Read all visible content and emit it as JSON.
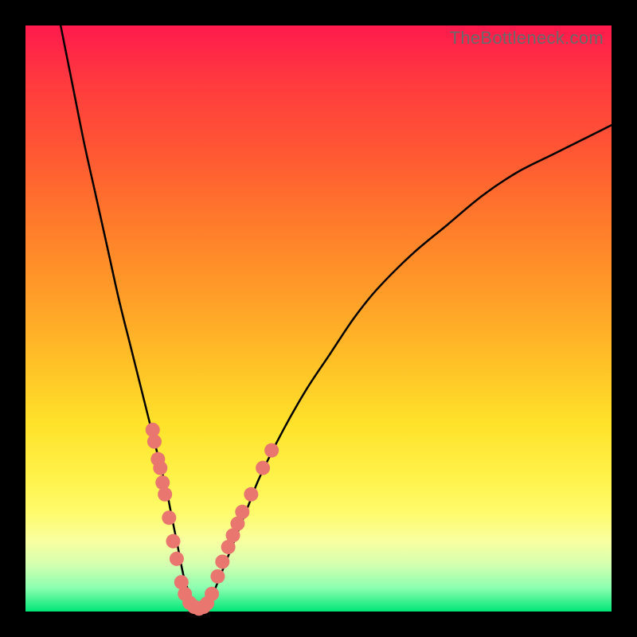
{
  "watermark": "TheBottleneck.com",
  "colors": {
    "curve_stroke": "#000000",
    "dot_fill": "#e9776f",
    "dot_stroke": "#c95b55"
  },
  "chart_data": {
    "type": "line",
    "title": "",
    "xlabel": "",
    "ylabel": "",
    "xlim": [
      0,
      100
    ],
    "ylim": [
      0,
      100
    ],
    "series": [
      {
        "name": "bottleneck-curve",
        "x": [
          6,
          8,
          10,
          12,
          14,
          16,
          18,
          20,
          22,
          23,
          24,
          25,
          26,
          27,
          28,
          29,
          30,
          31,
          32,
          34,
          36,
          38,
          40,
          44,
          48,
          52,
          56,
          60,
          66,
          72,
          78,
          84,
          90,
          96,
          100
        ],
        "y": [
          100,
          90,
          80,
          71,
          62,
          53,
          45,
          37,
          29,
          25,
          21,
          16,
          11,
          6,
          3,
          1,
          0,
          1,
          3,
          8,
          13,
          18,
          23,
          31,
          38,
          44,
          50,
          55,
          61,
          66,
          71,
          75,
          78,
          81,
          83
        ]
      }
    ],
    "dots": {
      "name": "highlighted-points",
      "points": [
        {
          "x": 21.7,
          "y": 31
        },
        {
          "x": 22.0,
          "y": 29
        },
        {
          "x": 22.6,
          "y": 26
        },
        {
          "x": 23.0,
          "y": 24.5
        },
        {
          "x": 23.4,
          "y": 22
        },
        {
          "x": 23.8,
          "y": 20
        },
        {
          "x": 24.5,
          "y": 16
        },
        {
          "x": 25.2,
          "y": 12
        },
        {
          "x": 25.8,
          "y": 9
        },
        {
          "x": 26.6,
          "y": 5
        },
        {
          "x": 27.2,
          "y": 3
        },
        {
          "x": 28.0,
          "y": 1.5
        },
        {
          "x": 28.8,
          "y": 0.8
        },
        {
          "x": 29.6,
          "y": 0.5
        },
        {
          "x": 30.4,
          "y": 0.8
        },
        {
          "x": 31.0,
          "y": 1.4
        },
        {
          "x": 31.8,
          "y": 3
        },
        {
          "x": 32.8,
          "y": 6
        },
        {
          "x": 33.6,
          "y": 8.5
        },
        {
          "x": 34.6,
          "y": 11
        },
        {
          "x": 35.4,
          "y": 13
        },
        {
          "x": 36.2,
          "y": 15
        },
        {
          "x": 37.0,
          "y": 17
        },
        {
          "x": 38.5,
          "y": 20
        },
        {
          "x": 40.5,
          "y": 24.5
        },
        {
          "x": 42.0,
          "y": 27.5
        }
      ]
    }
  }
}
